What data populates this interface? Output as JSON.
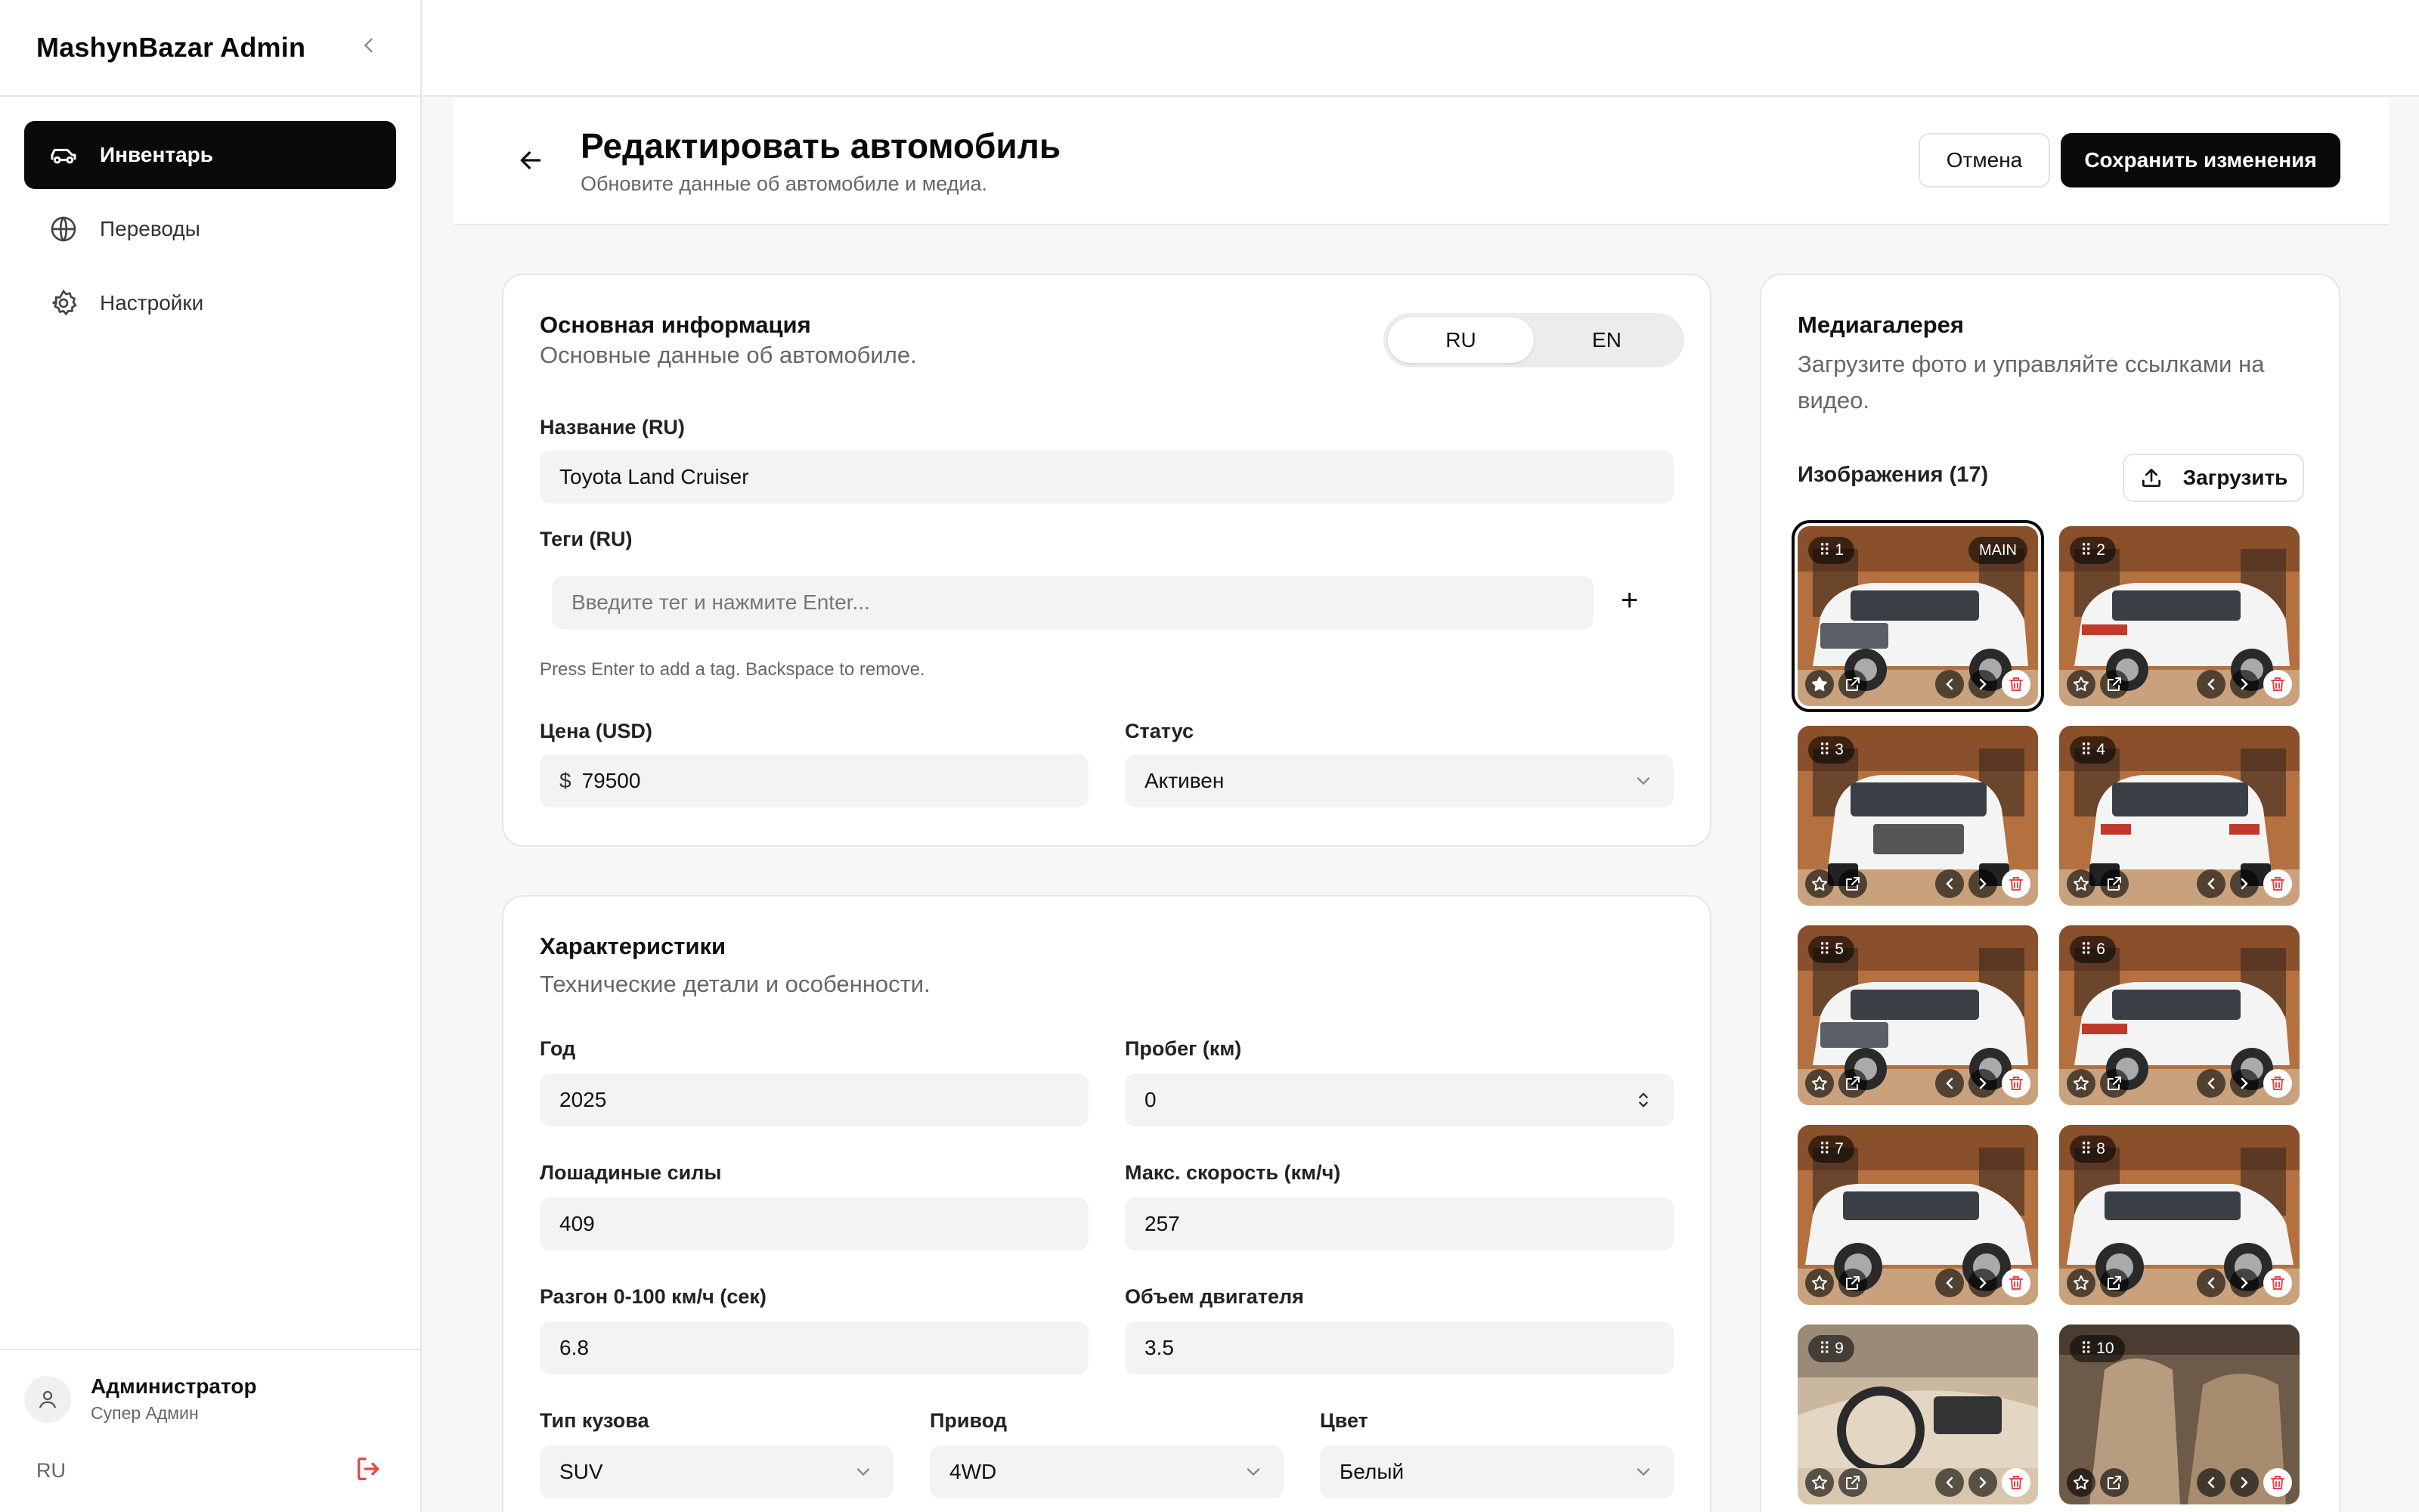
{
  "sidebar": {
    "brand": "MashynBazar Admin",
    "items": [
      {
        "label": "Инвентарь",
        "icon": "car-icon",
        "active": true
      },
      {
        "label": "Переводы",
        "icon": "globe-icon",
        "active": false
      },
      {
        "label": "Настройки",
        "icon": "gear-icon",
        "active": false
      }
    ],
    "user": {
      "name": "Администратор",
      "role": "Супер Админ"
    },
    "language": "RU"
  },
  "header": {
    "title": "Редактировать автомобиль",
    "subtitle": "Обновите данные об автомобиле и медиа.",
    "cancel_label": "Отмена",
    "save_label": "Сохранить изменения"
  },
  "basic": {
    "title": "Основная информация",
    "subtitle": "Основные данные об автомобиле.",
    "lang_options": [
      "RU",
      "EN"
    ],
    "lang_selected": "RU",
    "name_label": "Название (RU)",
    "name_value": "Toyota Land Cruiser",
    "tags_label": "Теги (RU)",
    "tags_placeholder": "Введите тег и нажмите Enter...",
    "tags_hint": "Press Enter to add a tag. Backspace to remove.",
    "price_label": "Цена (USD)",
    "price_currency": "$",
    "price_value": "79500",
    "status_label": "Статус",
    "status_value": "Активен"
  },
  "specs": {
    "title": "Характеристики",
    "subtitle": "Технические детали и особенности.",
    "year_label": "Год",
    "year_value": "2025",
    "mileage_label": "Пробег (км)",
    "mileage_value": "0",
    "hp_label": "Лошадиные силы",
    "hp_value": "409",
    "speed_label": "Макс. скорость (км/ч)",
    "speed_value": "257",
    "accel_label": "Разгон 0-100 км/ч (сек)",
    "accel_value": "6.8",
    "engine_label": "Объем двигателя",
    "engine_value": "3.5",
    "body_label": "Тип кузова",
    "body_value": "SUV",
    "drive_label": "Привод",
    "drive_value": "4WD",
    "color_label": "Цвет",
    "color_value": "Белый"
  },
  "media": {
    "title": "Медиагалерея",
    "subtitle": "Загрузите фото и управляйте ссылками на видео.",
    "images_label": "Изображения (17)",
    "upload_label": "Загрузить",
    "main_badge": "MAIN",
    "thumbs": [
      {
        "n": "1",
        "view": "front-3q",
        "interior": false
      },
      {
        "n": "2",
        "view": "rear-3q",
        "interior": false
      },
      {
        "n": "3",
        "view": "front",
        "interior": false
      },
      {
        "n": "4",
        "view": "rear",
        "interior": false
      },
      {
        "n": "5",
        "view": "front-3q",
        "interior": false
      },
      {
        "n": "6",
        "view": "rear-3q",
        "interior": false
      },
      {
        "n": "7",
        "view": "side-front",
        "interior": false
      },
      {
        "n": "8",
        "view": "side",
        "interior": false
      },
      {
        "n": "9",
        "view": "dashboard",
        "interior": true
      },
      {
        "n": "10",
        "view": "seats",
        "interior": true
      }
    ]
  },
  "colors": {
    "accent": "#0a0a0a",
    "danger": "#e5484d",
    "muted": "#666666"
  }
}
